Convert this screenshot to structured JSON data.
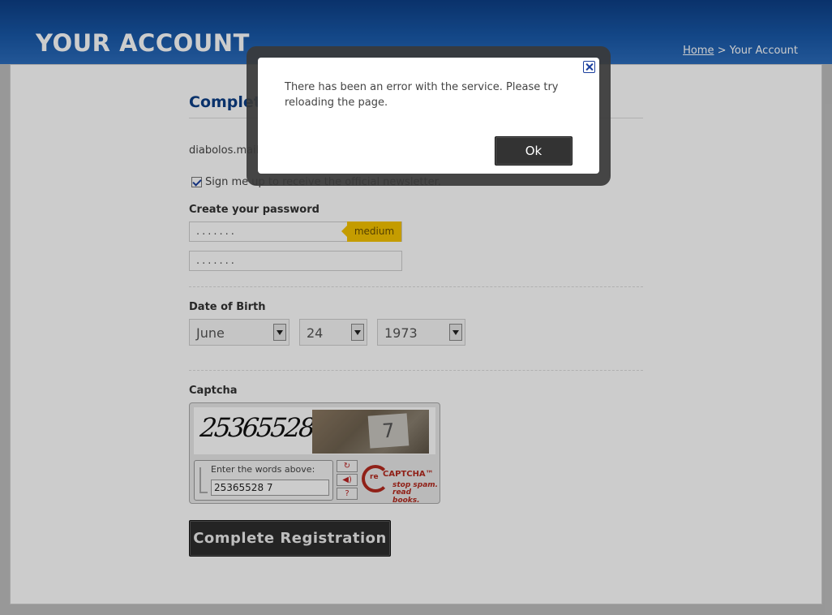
{
  "header": {
    "title": "YOUR ACCOUNT",
    "breadcrumb": {
      "home": "Home",
      "separator": " > ",
      "current": "Your Account"
    }
  },
  "form": {
    "section_title": "Complete",
    "email": "diabolos.mail",
    "newsletter_label": "Sign me up to receive the official newsletter.",
    "newsletter_checked": true,
    "password_label": "Create your password",
    "password_value": ".......",
    "password_strength": "medium",
    "confirm_value": ".......",
    "dob_label": "Date of Birth",
    "dob_month": "June",
    "dob_day": "24",
    "dob_year": "1973",
    "captcha_label": "Captcha",
    "captcha_words": "25365528",
    "captcha_photo_text": "7",
    "captcha_prompt": "Enter the words above:",
    "captcha_input": "25365528 7",
    "recaptcha_brand_prefix": "re",
    "recaptcha_brand": "CAPTCHA™",
    "recaptcha_tag1": "stop spam.",
    "recaptcha_tag2": "read books.",
    "submit_label": "Complete Registration"
  },
  "modal": {
    "message": "There has been an error with the service. Please try reloading the page.",
    "ok_label": "Ok"
  },
  "colors": {
    "header_blue": "#1858a8",
    "title_blue": "#0d3f86",
    "strength_yellow": "#f5c400",
    "button_dark": "#2d2d2d"
  }
}
